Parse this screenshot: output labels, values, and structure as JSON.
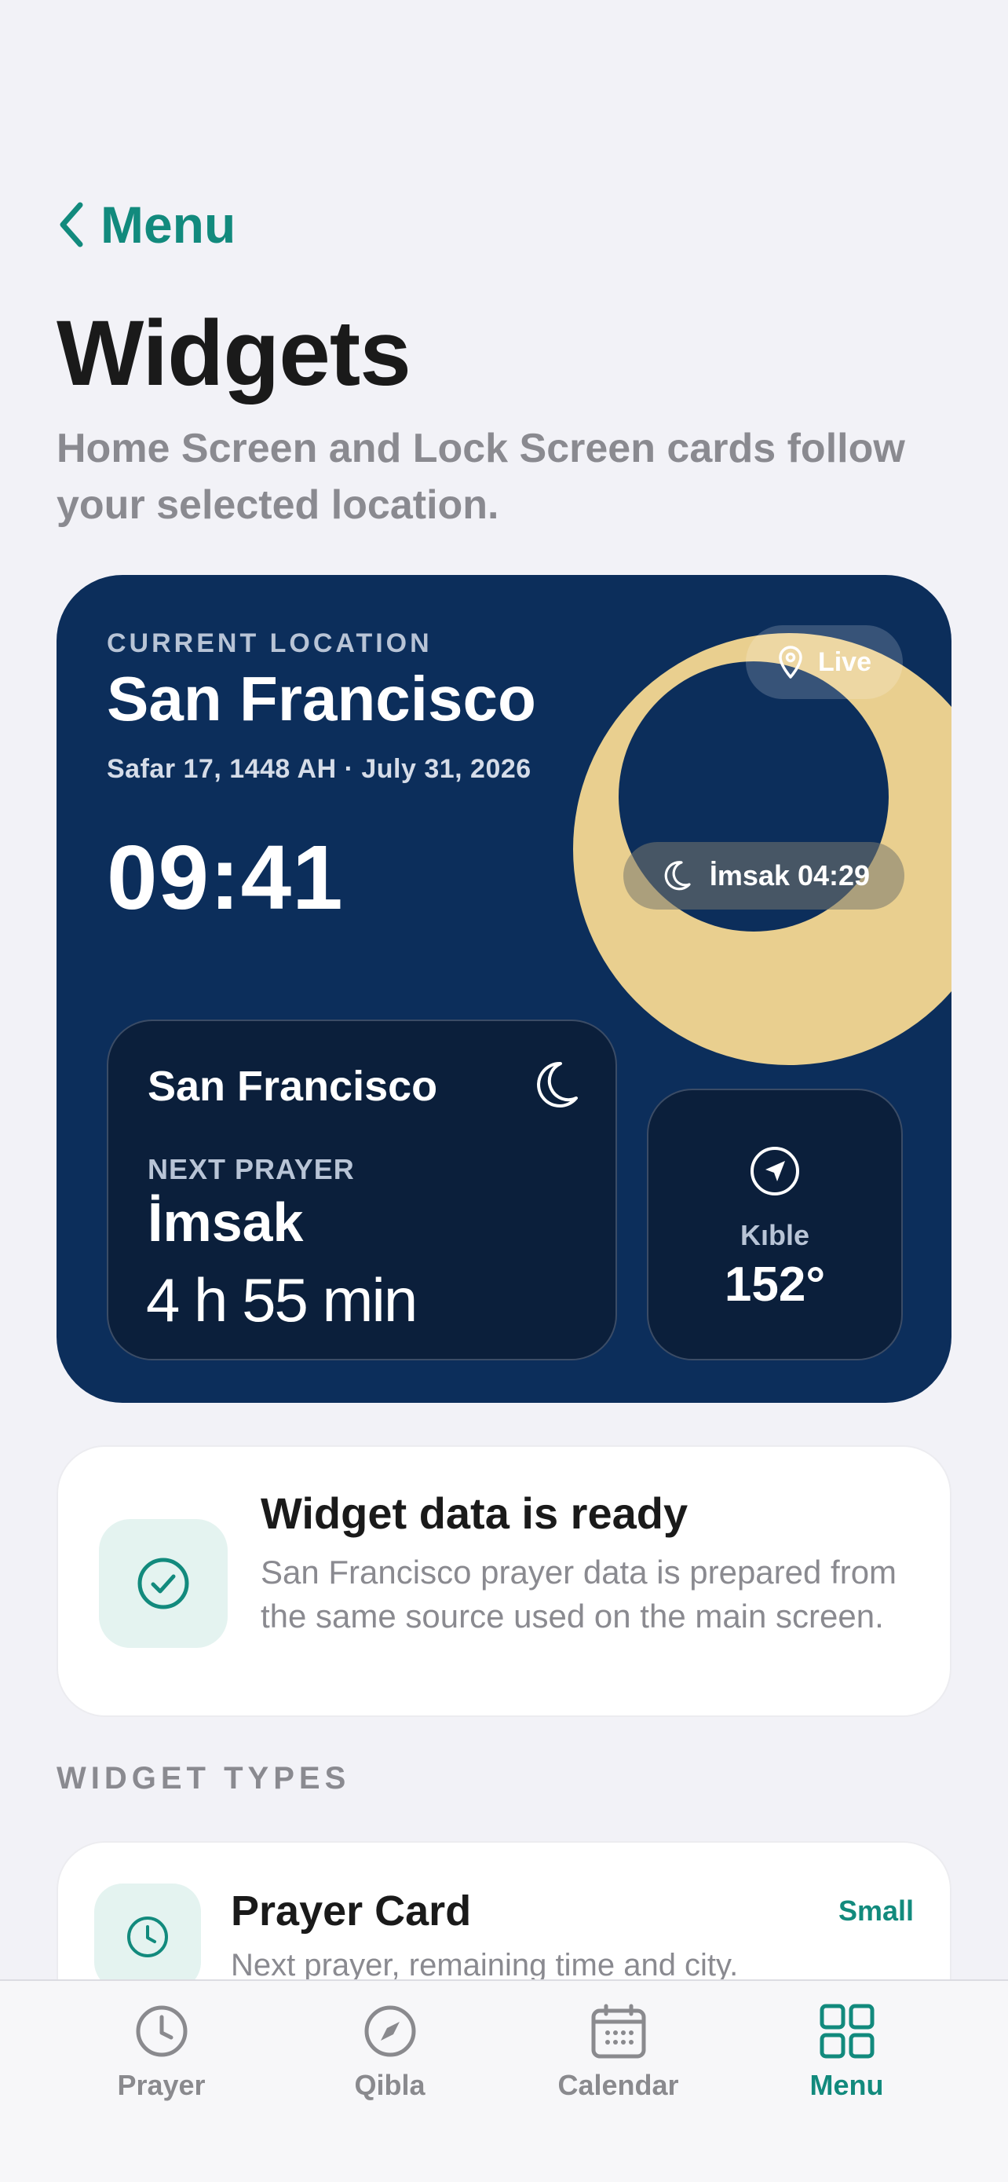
{
  "nav": {
    "back_label": "Menu"
  },
  "header": {
    "title": "Widgets",
    "subtitle": "Home Screen and Lock Screen cards follow your selected location."
  },
  "hero": {
    "location_label": "CURRENT LOCATION",
    "city": "San Francisco",
    "date": "Safar 17, 1448 AH · July 31, 2026",
    "time": "09:41",
    "live_label": "Live",
    "imsak_pill": "İmsak 04:29",
    "next_card": {
      "city": "San Francisco",
      "label": "NEXT PRAYER",
      "prayer": "İmsak",
      "remaining": "4 h 55 min"
    },
    "qibla": {
      "label": "Kıble",
      "value": "152°"
    }
  },
  "ready_card": {
    "title": "Widget data is ready",
    "description": "San Francisco prayer data is prepared from the same source used on the main screen."
  },
  "widget_types": {
    "section_label": "WIDGET TYPES",
    "items": [
      {
        "title": "Prayer Card",
        "description": "Next prayer, remaining time and city.",
        "size": "Small",
        "icon": "clock-icon"
      }
    ]
  },
  "tab_bar": {
    "tabs": [
      {
        "label": "Prayer",
        "icon": "clock-icon",
        "active": false
      },
      {
        "label": "Qibla",
        "icon": "compass-icon",
        "active": false
      },
      {
        "label": "Calendar",
        "icon": "calendar-icon",
        "active": false
      },
      {
        "label": "Menu",
        "icon": "grid-icon",
        "active": true
      }
    ]
  },
  "colors": {
    "accent": "#128a7d",
    "hero_background": "#0c2e5b",
    "sun_ring": "#e9cf8f",
    "page_background": "#f2f2f7"
  }
}
